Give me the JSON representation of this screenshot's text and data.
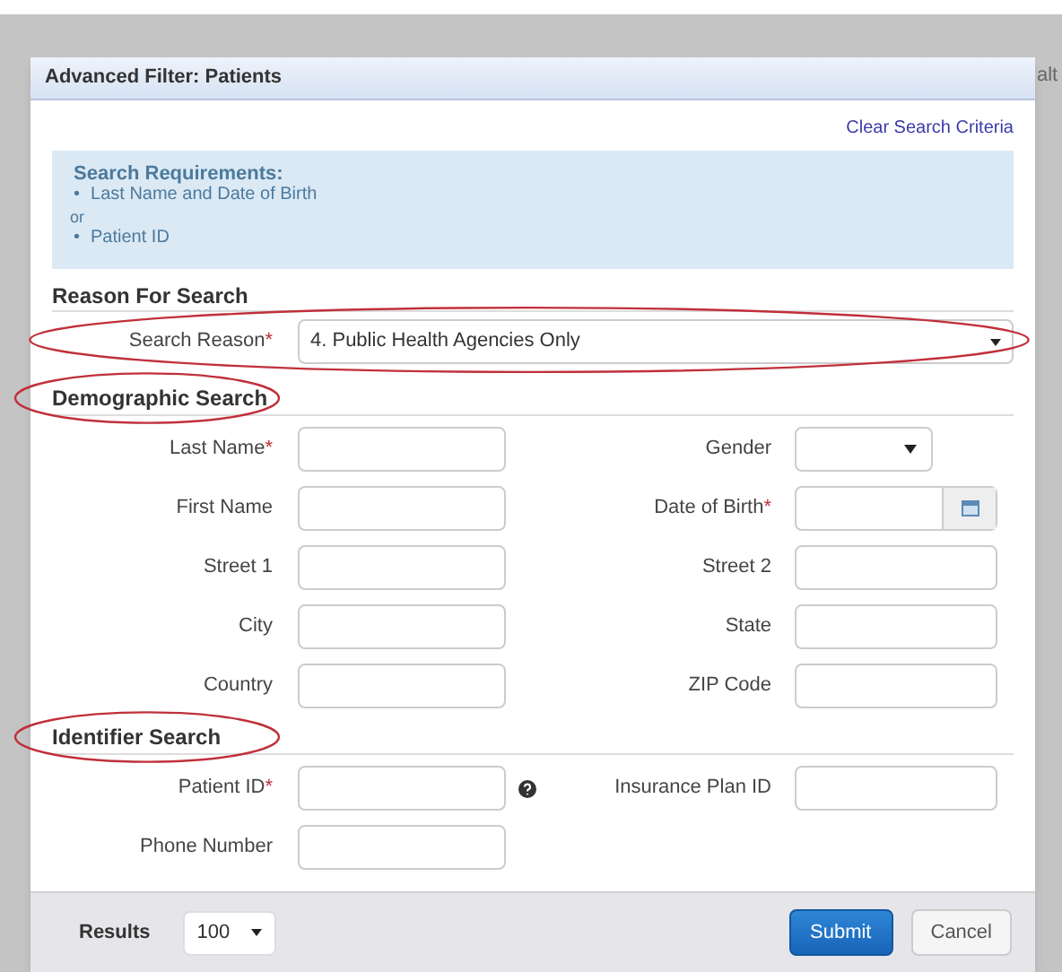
{
  "backdrop_text": "alt",
  "dialog": {
    "title": "Advanced Filter: Patients",
    "clear_link": "Clear Search Criteria",
    "requirements": {
      "title": "Search Requirements:",
      "items": [
        "Last Name and Date of Birth",
        "Patient ID"
      ],
      "separator": "or",
      "bullet": "•"
    },
    "reason": {
      "title": "Reason For Search",
      "label": "Search Reason",
      "required_mark": "*",
      "value": "4. Public Health Agencies Only",
      "annotated": true
    },
    "sections": [
      {
        "title": "Demographic Search",
        "annotated": true,
        "fields": [
          {
            "label": "Last Name",
            "required_mark": "*",
            "kind": "text"
          },
          {
            "label": "Gender",
            "kind": "select"
          },
          {
            "label": "First Name",
            "kind": "text"
          },
          {
            "label": "Date of Birth",
            "required_mark": "*",
            "kind": "date"
          },
          {
            "label": "Street 1",
            "kind": "text"
          },
          {
            "label": "Street 2",
            "kind": "text"
          },
          {
            "label": "City",
            "kind": "text"
          },
          {
            "label": "State",
            "kind": "text"
          },
          {
            "label": "Country",
            "kind": "text"
          },
          {
            "label": "ZIP Code",
            "kind": "text"
          }
        ]
      },
      {
        "title": "Identifier Search",
        "annotated": true,
        "fields": [
          {
            "label": "Patient ID",
            "required_mark": "*",
            "kind": "text",
            "help": true
          },
          {
            "label": "Insurance Plan ID",
            "kind": "text"
          },
          {
            "label": "Phone Number",
            "kind": "text"
          }
        ]
      }
    ],
    "footer": {
      "results_label": "Results",
      "results_value": "100",
      "buttons": [
        {
          "label": "Submit",
          "kind": "primary"
        },
        {
          "label": "Cancel",
          "kind": "default"
        }
      ]
    }
  }
}
